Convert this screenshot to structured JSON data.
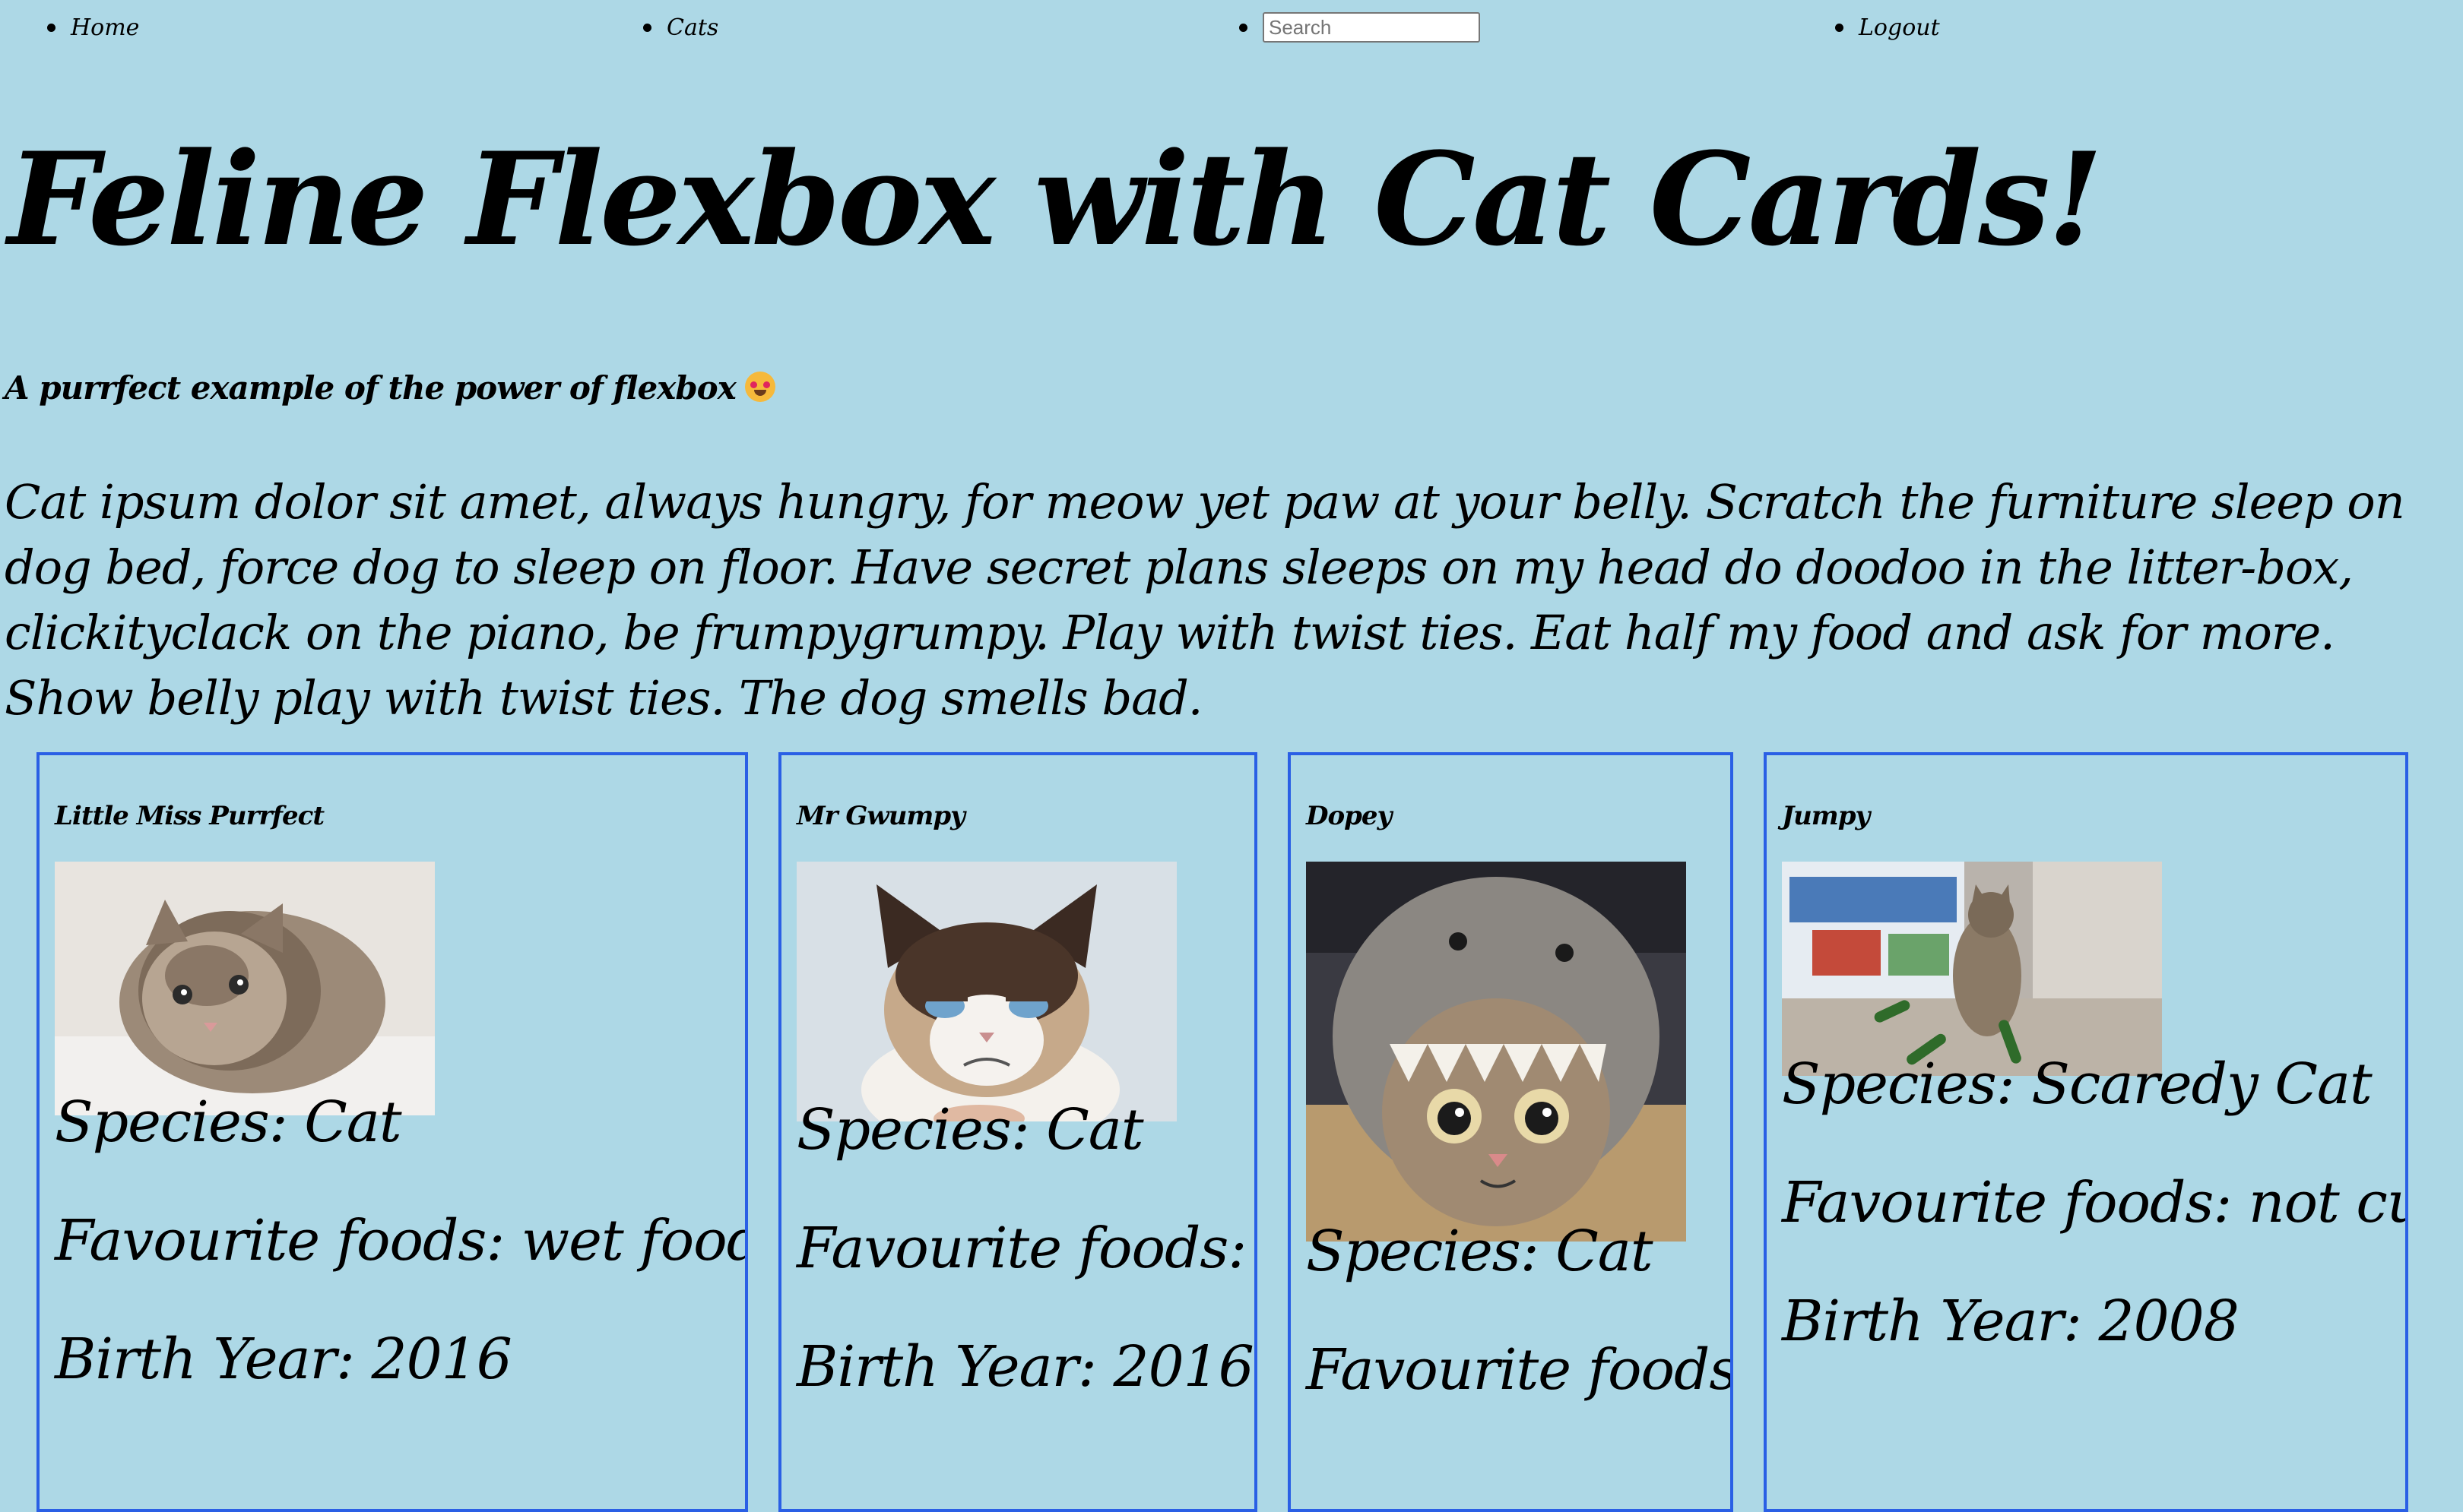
{
  "nav": {
    "home": "Home",
    "cats": "Cats",
    "search_placeholder": "Search",
    "logout": "Logout"
  },
  "header": {
    "title": "Feline Flexbox with Cat Cards!",
    "subtitle": "A purrfect example of the power of flexbox",
    "subtitle_emoji": "smiling-cat-heart-eyes-emoji"
  },
  "intro": "Cat ipsum dolor sit amet, always hungry, for meow yet paw at your belly. Scratch the furniture sleep on dog bed, force dog to sleep on floor. Have secret plans sleeps on my head do doodoo in the litter-box, clickityclack on the piano, be frumpygrumpy. Play with twist ties. Eat half my food and ask for more. Show belly play with twist ties. The dog smells bad.",
  "cards": [
    {
      "name": "Little Miss Purrfect",
      "photo": "fluffy-kitten-photo",
      "species": "Species: Cat",
      "foods": "Favourite foods: wet food, dry food",
      "birth": "Birth Year: 2016"
    },
    {
      "name": "Mr Gwumpy",
      "photo": "grumpy-cat-photo",
      "species": "Species: Cat",
      "foods": "Favourite foods: caviar",
      "birth": "Birth Year: 2016"
    },
    {
      "name": "Dopey",
      "photo": "cat-in-shark-hat-photo",
      "species": "Species: Cat",
      "foods": "Favourite foods: bugs",
      "birth": ""
    },
    {
      "name": "Jumpy",
      "photo": "cat-with-cucumbers-photo",
      "species": "Species: Scaredy Cat",
      "foods": "Favourite foods: not cucumbers!",
      "birth": "Birth Year: 2008"
    }
  ],
  "colors": {
    "background": "#add8e6",
    "card_border": "#2a5fe5"
  }
}
